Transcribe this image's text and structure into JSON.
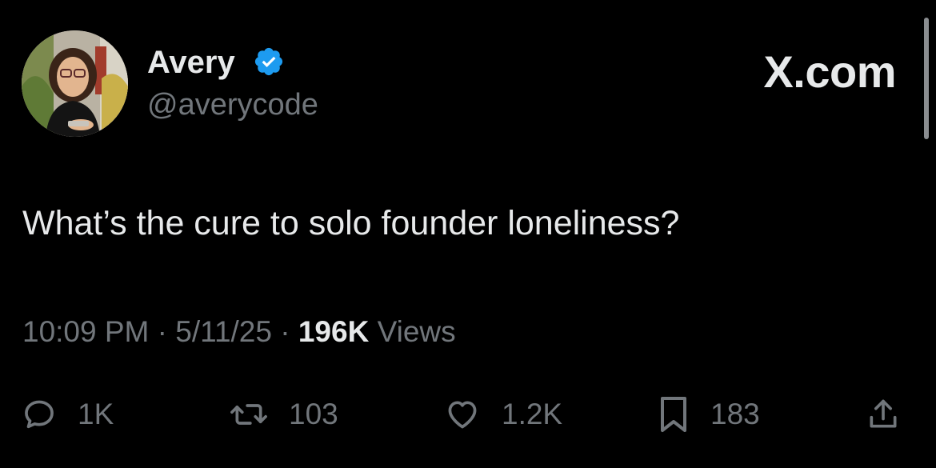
{
  "author": {
    "display_name": "Avery",
    "handle": "@averycode",
    "verified": true
  },
  "site_label": "X.com",
  "tweet": {
    "text": "What’s the cure to solo founder loneliness?",
    "time": "10:09 PM",
    "date": "5/11/25",
    "views_count": "196K",
    "views_label": "Views"
  },
  "actions": {
    "replies": "1K",
    "reposts": "103",
    "likes": "1.2K",
    "bookmarks": "183"
  },
  "icons": {
    "verified": "verified-badge-icon",
    "reply": "speech-bubble-icon",
    "repost": "repost-arrows-icon",
    "like": "heart-icon",
    "bookmark": "bookmark-icon",
    "share": "share-upload-icon"
  },
  "colors": {
    "background": "#000000",
    "primary_text": "#e7e9ea",
    "secondary_text": "#71767b",
    "verified_blue": "#1d9bf0"
  }
}
